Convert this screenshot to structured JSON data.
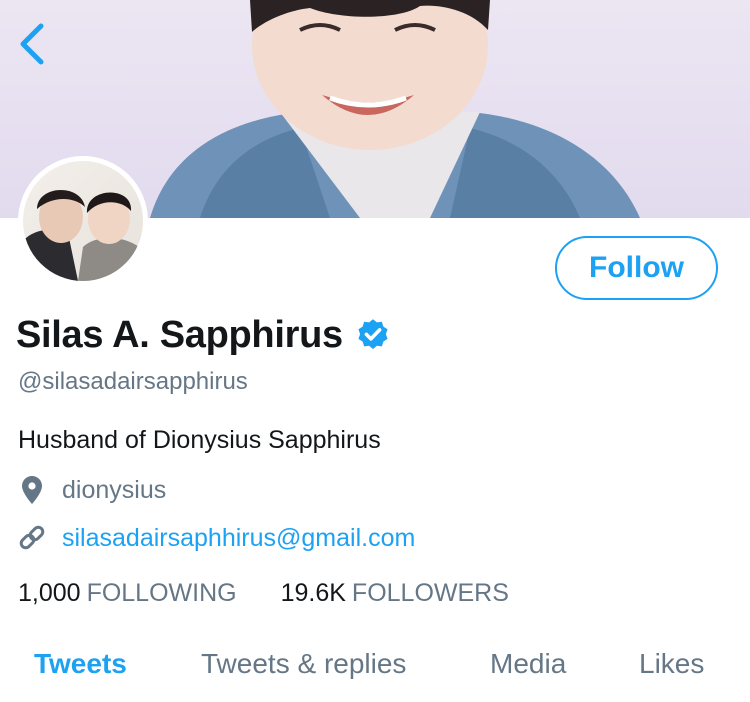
{
  "header": {
    "back_icon": "chevron-left-icon"
  },
  "profile": {
    "display_name": "Silas A. Sapphirus",
    "verified_icon": "verified-badge-icon",
    "handle": "@silasadairsapphirus",
    "bio": "Husband of Dionysius Sapphirus",
    "location": "dionysius",
    "location_icon": "location-pin-icon",
    "link": "silasadairsaphhirus@gmail.com",
    "link_icon": "link-icon",
    "follow_label": "Follow"
  },
  "stats": {
    "following_count": "1,000",
    "following_label": "FOLLOWING",
    "followers_count": "19.6K",
    "followers_label": "FOLLOWERS"
  },
  "tabs": [
    {
      "label": "Tweets",
      "active": true
    },
    {
      "label": "Tweets & replies",
      "active": false
    },
    {
      "label": "Media",
      "active": false
    },
    {
      "label": "Likes",
      "active": false
    }
  ],
  "colors": {
    "accent": "#1da1f2",
    "secondary_text": "#657786",
    "primary_text": "#14171a",
    "banner_bg": "#e6dff0"
  }
}
